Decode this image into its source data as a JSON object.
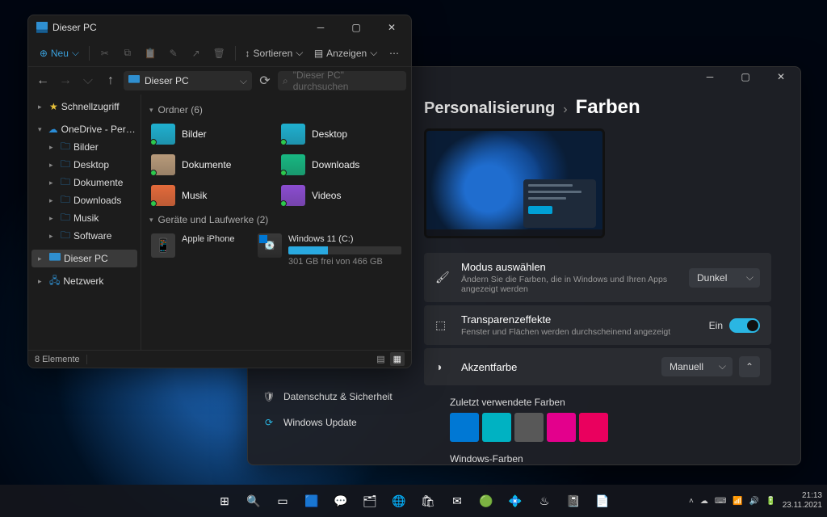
{
  "taskbar": {
    "time": "21:13",
    "date": "23.11.2021",
    "apps": [
      "start",
      "search",
      "taskview",
      "widgets",
      "chat",
      "explorer",
      "edge",
      "store",
      "mail",
      "spotify",
      "slack",
      "steam",
      "onenote",
      "word"
    ]
  },
  "explorer": {
    "title": "Dieser PC",
    "toolbar": {
      "new_label": "Neu",
      "sort_label": "Sortieren",
      "view_label": "Anzeigen"
    },
    "address": "Dieser PC",
    "search_placeholder": "\"Dieser PC\" durchsuchen",
    "sidebar": {
      "quickaccess": "Schnellzugriff",
      "onedrive": "OneDrive - Personal",
      "children": [
        {
          "label": "Bilder"
        },
        {
          "label": "Desktop"
        },
        {
          "label": "Dokumente"
        },
        {
          "label": "Downloads"
        },
        {
          "label": "Musik"
        },
        {
          "label": "Software"
        }
      ],
      "thispc": "Dieser PC",
      "network": "Netzwerk"
    },
    "groups": {
      "folders_label": "Ordner (6)",
      "folders": [
        {
          "name": "Bilder",
          "color": "#1fb0d0"
        },
        {
          "name": "Desktop",
          "color": "#1fb0d0"
        },
        {
          "name": "Dokumente",
          "color": "#b89a7a"
        },
        {
          "name": "Downloads",
          "color": "#18b882"
        },
        {
          "name": "Musik",
          "color": "#e36a3b"
        },
        {
          "name": "Videos",
          "color": "#8b4dd0"
        }
      ],
      "devices_label": "Geräte und Laufwerke (2)",
      "devices": [
        {
          "name": "Apple iPhone",
          "type": "phone"
        },
        {
          "name": "Windows 11 (C:)",
          "type": "disk",
          "free": "301 GB frei von 466 GB",
          "used_pct": 35
        }
      ]
    },
    "status": "8 Elemente"
  },
  "settings": {
    "side_items": [
      {
        "label": "Datenschutz & Sicherheit",
        "icon": "shield"
      },
      {
        "label": "Windows Update",
        "icon": "update"
      }
    ],
    "breadcrumb": {
      "back": "Personalisierung",
      "current": "Farben"
    },
    "mode": {
      "title": "Modus auswählen",
      "sub": "Ändern Sie die Farben, die in Windows und Ihren Apps angezeigt werden",
      "value": "Dunkel"
    },
    "transparency": {
      "title": "Transparenzeffekte",
      "sub": "Fenster und Flächen werden durchscheinend angezeigt",
      "state_label": "Ein"
    },
    "accent": {
      "title": "Akzentfarbe",
      "value": "Manuell",
      "recent_label": "Zuletzt verwendete Farben",
      "recent": [
        "#0078d4",
        "#00b2c2",
        "#585858",
        "#e3008c",
        "#ea005e"
      ],
      "windows_label": "Windows-Farben",
      "windows": [
        "#ffb900",
        "#ff8c00",
        "#f7630c",
        "#ca5010",
        "#da3b01",
        "#ef6950",
        "#d13438",
        "#ff4343"
      ]
    }
  }
}
